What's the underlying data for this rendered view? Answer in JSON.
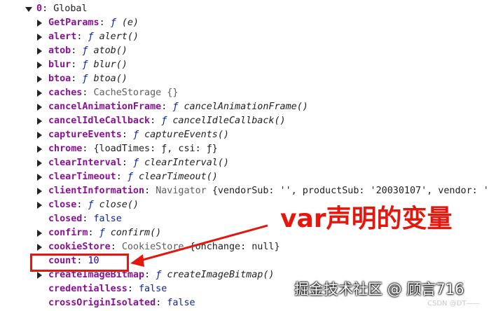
{
  "header": {
    "index": "0",
    "sep": ": ",
    "label": "Global"
  },
  "rows": [
    {
      "key": "GetParams",
      "kind": "fn",
      "sig": "(e)",
      "tri": true
    },
    {
      "key": "alert",
      "kind": "fn",
      "sig": "alert()",
      "tri": true
    },
    {
      "key": "atob",
      "kind": "fn",
      "sig": "atob()",
      "tri": true
    },
    {
      "key": "blur",
      "kind": "fn",
      "sig": "blur()",
      "tri": true
    },
    {
      "key": "btoa",
      "kind": "fn",
      "sig": "btoa()",
      "tri": true
    },
    {
      "key": "caches",
      "kind": "type",
      "text": "CacheStorage {}",
      "tri": true
    },
    {
      "key": "cancelAnimationFrame",
      "kind": "fn",
      "sig": "cancelAnimationFrame()",
      "tri": true
    },
    {
      "key": "cancelIdleCallback",
      "kind": "fn",
      "sig": "cancelIdleCallback()",
      "tri": true
    },
    {
      "key": "captureEvents",
      "kind": "fn",
      "sig": "captureEvents()",
      "tri": true
    },
    {
      "key": "chrome",
      "kind": "obj",
      "text": "{loadTimes: ƒ, csi: ƒ}",
      "tri": true
    },
    {
      "key": "clearInterval",
      "kind": "fn",
      "sig": "clearInterval()",
      "tri": true
    },
    {
      "key": "clearTimeout",
      "kind": "fn",
      "sig": "clearTimeout()",
      "tri": true
    },
    {
      "key": "clientInformation",
      "kind": "nav",
      "type": "Navigator",
      "text": "{vendorSub: '', productSub: '20030107', vendor: '",
      "tri": true
    },
    {
      "key": "close",
      "kind": "fn",
      "sig": "close()",
      "tri": true
    },
    {
      "key": "closed",
      "kind": "bool",
      "text": "false",
      "tri": false
    },
    {
      "key": "confirm",
      "kind": "fn",
      "sig": "confirm()",
      "tri": true
    },
    {
      "key": "cookieStore",
      "kind": "cookie",
      "type": "CookieStore",
      "text": "{onchange: null}",
      "tri": true
    },
    {
      "key": "count",
      "kind": "num",
      "text": "10",
      "tri": false
    },
    {
      "key": "createImageBitmap",
      "kind": "fn",
      "sig": "createImageBitmap()",
      "tri": true
    },
    {
      "key": "credentialless",
      "kind": "bool",
      "text": "false",
      "tri": false
    },
    {
      "key": "crossOriginIsolated",
      "kind": "bool",
      "text": "false",
      "tri": false
    }
  ],
  "fglyph": "ƒ",
  "annotation": "var声明的变量",
  "watermark": "掘金技术社区 @ 顾言716",
  "watermark_small": "CSDN @DT——",
  "colors": {
    "accent": "#e3170d",
    "key": "#881391",
    "number": "#1c00cf",
    "string": "#c41a16"
  },
  "icons": {
    "expanded": "triangle-down-icon",
    "collapsed": "triangle-right-icon"
  }
}
